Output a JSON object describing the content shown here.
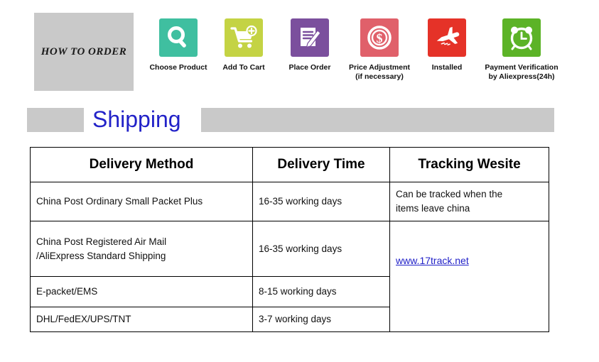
{
  "how_to_order": {
    "title": "HOW  TO  ORDER"
  },
  "steps": [
    {
      "label": "Choose Product",
      "sub": "",
      "icon": "search-icon",
      "color": "#3fbfa0"
    },
    {
      "label": "Add To Cart",
      "sub": "",
      "icon": "shopping-cart-plus-icon",
      "color": "#c4d344"
    },
    {
      "label": "Place Order",
      "sub": "",
      "icon": "document-pen-icon",
      "color": "#7b4f9d"
    },
    {
      "label": "Price  Adjustment",
      "sub": "(if necessary)",
      "icon": "dollar-coin-icon",
      "color": "#e0606a"
    },
    {
      "label": "Installed",
      "sub": "",
      "icon": "airplane-icon",
      "color": "#e53228"
    },
    {
      "label": "Payment Verification",
      "sub": "by Aliexpress(24h)",
      "icon": "alarm-clock-icon",
      "color": "#5cb327"
    }
  ],
  "shipping": {
    "title": "Shipping",
    "title_color": "#2222c8",
    "bar_color": "#c9c9c9"
  },
  "table": {
    "headers": [
      "Delivery Method",
      "Delivery Time",
      "Tracking Wesite"
    ],
    "rows": [
      {
        "method": "China Post Ordinary Small Packet Plus",
        "time": "16-35 working days",
        "tracking": "Can be tracked when the\nitems leave china"
      },
      {
        "method": "China Post Registered Air Mail\n/AliExpress Standard Shipping",
        "time": "16-35 working days"
      },
      {
        "method": "E-packet/EMS",
        "time": "8-15 working days"
      },
      {
        "method": "DHL/FedEX/UPS/TNT",
        "time": "3-7 working days"
      }
    ],
    "tracking_link": "www.17track.net",
    "tracking_link_color": "#2222c8"
  }
}
